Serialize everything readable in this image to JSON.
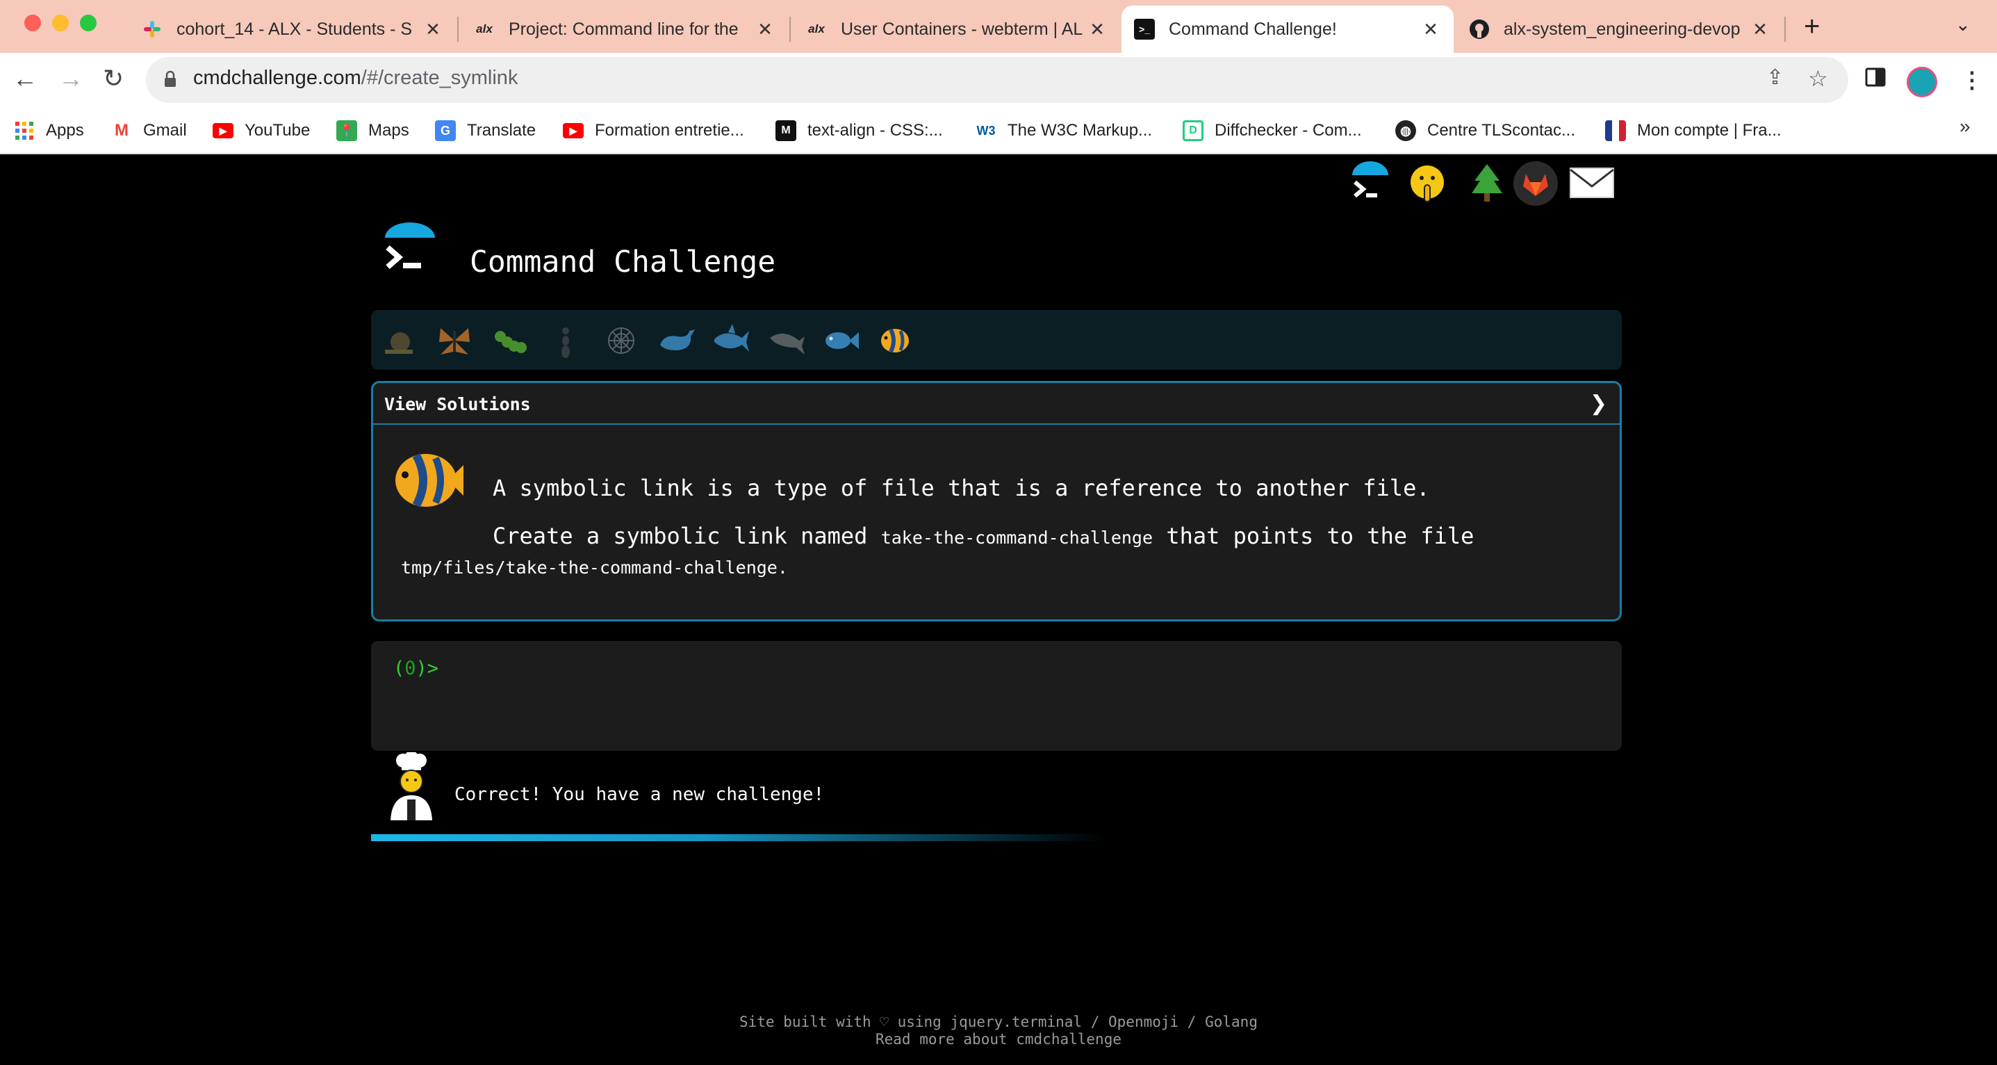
{
  "browser": {
    "tabs": [
      {
        "title": "cohort_14 - ALX - Students - S",
        "icon": "slack-icon"
      },
      {
        "title": "Project: Command line for the",
        "icon": "alx-icon"
      },
      {
        "title": "User Containers - webterm | AL",
        "icon": "alx-icon"
      },
      {
        "title": "Command Challenge!",
        "icon": "terminal-icon",
        "active": true
      },
      {
        "title": "alx-system_engineering-devop",
        "icon": "github-icon"
      }
    ],
    "url_host": "cmdchallenge.com",
    "url_path": "/#/create_symlink",
    "bookmarks": [
      {
        "label": "Apps",
        "icon": "apps-grid-icon"
      },
      {
        "label": "Gmail",
        "icon": "gmail-icon"
      },
      {
        "label": "YouTube",
        "icon": "youtube-icon"
      },
      {
        "label": "Maps",
        "icon": "maps-icon"
      },
      {
        "label": "Translate",
        "icon": "translate-icon"
      },
      {
        "label": "Formation entretie...",
        "icon": "youtube-icon"
      },
      {
        "label": "text-align - CSS:...",
        "icon": "mdn-icon"
      },
      {
        "label": "The W3C Markup...",
        "icon": "w3c-icon"
      },
      {
        "label": "Diffchecker - Com...",
        "icon": "diffchecker-icon"
      },
      {
        "label": "Centre TLScontac...",
        "icon": "globe-icon"
      },
      {
        "label": "Mon compte | Fra...",
        "icon": "france-flag-icon"
      }
    ],
    "more_bookmarks": "»"
  },
  "page": {
    "title": "Command Challenge",
    "top_icons": [
      "terminal-logo-icon",
      "shushing-face-icon",
      "tree-icon",
      "gitlab-icon",
      "envelope-icon"
    ],
    "levels": [
      "snail-icon",
      "butterfly-icon",
      "caterpillar-icon",
      "ant-icon",
      "spider-web-icon",
      "whale-icon",
      "shark-icon",
      "dolphin-icon",
      "fish-icon",
      "tropical-fish-icon"
    ],
    "view_solutions": "View Solutions",
    "chevron": "❯",
    "description_line1": "A symbolic link is a type of file that is a reference to another file.",
    "description_line2_a": "Create a symbolic link named",
    "link_name": "take-the-command-challenge",
    "description_line2_b": "that points to the file",
    "target_file": "tmp/files/take-the-command-challenge",
    "period": ".",
    "prompt_open": "(",
    "prompt_count": "0",
    "prompt_close": ")>",
    "status_message": "Correct! You have a new challenge!",
    "progress": 0.4,
    "footer_line1": "Site built with ♡ using jquery.terminal / Openmoji / Golang",
    "footer_line2": "Read more about cmdchallenge"
  },
  "colors": {
    "tabstrip": "#f6c9bb",
    "accent": "#1a7fa0",
    "prompt_green": "#2fd135"
  }
}
